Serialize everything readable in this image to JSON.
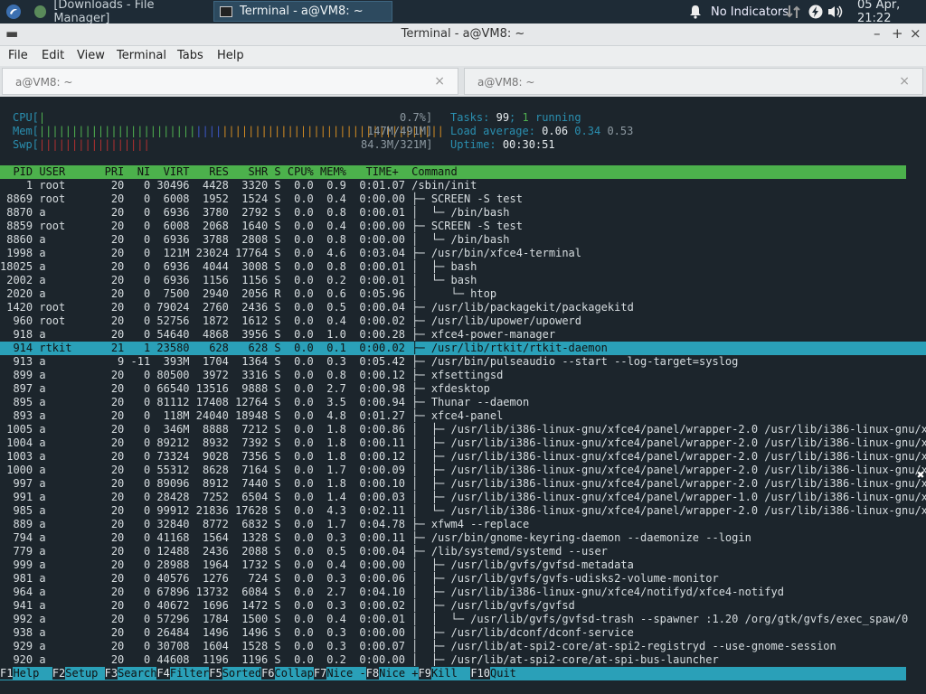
{
  "panel": {
    "task1": "[Downloads - File Manager]",
    "task2": "Terminal - a@VM8: ~",
    "indicators": "No Indicators",
    "clock": "05 Apr, 21:22"
  },
  "window": {
    "title": "Terminal - a@VM8: ~",
    "menu": [
      "File",
      "Edit",
      "View",
      "Terminal",
      "Tabs",
      "Help"
    ],
    "tabs": [
      {
        "label": "a@VM8: ~",
        "close": "×"
      },
      {
        "label": "a@VM8: ~",
        "close": "×"
      }
    ]
  },
  "htop": {
    "cpu": {
      "label": "CPU[",
      "bar": "|",
      "value": "0.7%]"
    },
    "mem": {
      "label": "Mem[",
      "bar_used": "||||||||||||||||||||||||",
      "bar_buf": "||||",
      "bar_cache": "||||||||||||||||||||||||||||||||||",
      "value": "147M/491M]"
    },
    "swp": {
      "label": "Swp[",
      "bar": "|||||||||||||||||",
      "value": "84.3M/321M]"
    },
    "tasks": {
      "label": "Tasks:",
      "count": "99",
      "sep": ";",
      "running": "1",
      "running_label": "running"
    },
    "load": {
      "label": "Load average:",
      "one": "0.06",
      "five": "0.34",
      "fifteen": "0.53"
    },
    "uptime": {
      "label": "Uptime:",
      "value": "00:30:51"
    },
    "header": "  PID USER      PRI  NI  VIRT   RES   SHR S CPU% MEM%   TIME+  Command",
    "rows": [
      "    1 root       20   0 30496  4428  3320 S  0.0  0.9  0:01.07 /sbin/init",
      " 8869 root       20   0  6008  1952  1524 S  0.0  0.4  0:00.00 ├─ SCREEN -S test",
      " 8870 a          20   0  6936  3780  2792 S  0.0  0.8  0:00.01 │  └─ /bin/bash",
      " 8859 root       20   0  6008  2068  1640 S  0.0  0.4  0:00.00 ├─ SCREEN -S test",
      " 8860 a          20   0  6936  3788  2808 S  0.0  0.8  0:00.00 │  └─ /bin/bash",
      " 1998 a          20   0  121M 23024 17764 S  0.0  4.6  0:03.04 ├─ /usr/bin/xfce4-terminal",
      "18025 a          20   0  6936  4044  3008 S  0.0  0.8  0:00.01 │  ├─ bash",
      " 2002 a          20   0  6936  1156  1156 S  0.0  0.2  0:00.01 │  └─ bash",
      " 2020 a          20   0  7500  2940  2056 R  0.0  0.6  0:05.96 │     └─ htop",
      " 1420 root       20   0 79024  2760  2436 S  0.0  0.5  0:00.04 ├─ /usr/lib/packagekit/packagekitd",
      "  960 root       20   0 52756  1872  1612 S  0.0  0.4  0:00.02 ├─ /usr/lib/upower/upowerd",
      "  918 a          20   0 54640  4868  3956 S  0.0  1.0  0:00.28 ├─ xfce4-power-manager",
      "  914 rtkit      21   1 23580   628   628 S  0.0  0.1  0:00.02 ├─ /usr/lib/rtkit/rtkit-daemon",
      "  913 a           9 -11  393M  1704  1364 S  0.0  0.3  0:05.42 ├─ /usr/bin/pulseaudio --start --log-target=syslog",
      "  899 a          20   0 80500  3972  3316 S  0.0  0.8  0:00.12 ├─ xfsettingsd",
      "  897 a          20   0 66540 13516  9888 S  0.0  2.7  0:00.98 ├─ xfdesktop",
      "  895 a          20   0 81112 17408 12764 S  0.0  3.5  0:00.94 ├─ Thunar --daemon",
      "  893 a          20   0  118M 24040 18948 S  0.0  4.8  0:01.27 ├─ xfce4-panel",
      " 1005 a          20   0  346M  8888  7212 S  0.0  1.8  0:00.86 │  ├─ /usr/lib/i386-linux-gnu/xfce4/panel/wrapper-2.0 /usr/lib/i386-linux-gnu/xf",
      " 1004 a          20   0 89212  8932  7392 S  0.0  1.8  0:00.11 │  ├─ /usr/lib/i386-linux-gnu/xfce4/panel/wrapper-2.0 /usr/lib/i386-linux-gnu/xf",
      " 1003 a          20   0 73324  9028  7356 S  0.0  1.8  0:00.12 │  ├─ /usr/lib/i386-linux-gnu/xfce4/panel/wrapper-2.0 /usr/lib/i386-linux-gnu/xf",
      " 1000 a          20   0 55312  8628  7164 S  0.0  1.7  0:00.09 │  ├─ /usr/lib/i386-linux-gnu/xfce4/panel/wrapper-2.0 /usr/lib/i386-linux-gnu/xf",
      "  997 a          20   0 89096  8912  7440 S  0.0  1.8  0:00.10 │  ├─ /usr/lib/i386-linux-gnu/xfce4/panel/wrapper-2.0 /usr/lib/i386-linux-gnu/xf",
      "  991 a          20   0 28428  7252  6504 S  0.0  1.4  0:00.03 │  ├─ /usr/lib/i386-linux-gnu/xfce4/panel/wrapper-1.0 /usr/lib/i386-linux-gnu/xf",
      "  985 a          20   0 99912 21836 17628 S  0.0  4.3  0:02.11 │  └─ /usr/lib/i386-linux-gnu/xfce4/panel/wrapper-2.0 /usr/lib/i386-linux-gnu/xf",
      "  889 a          20   0 32840  8772  6832 S  0.0  1.7  0:04.78 ├─ xfwm4 --replace",
      "  794 a          20   0 41168  1564  1328 S  0.0  0.3  0:00.11 ├─ /usr/bin/gnome-keyring-daemon --daemonize --login",
      "  779 a          20   0 12488  2436  2088 S  0.0  0.5  0:00.04 ├─ /lib/systemd/systemd --user",
      "  999 a          20   0 28988  1964  1732 S  0.0  0.4  0:00.00 │  ├─ /usr/lib/gvfs/gvfsd-metadata",
      "  981 a          20   0 40576  1276   724 S  0.0  0.3  0:00.06 │  ├─ /usr/lib/gvfs/gvfs-udisks2-volume-monitor",
      "  964 a          20   0 67896 13732  6084 S  0.0  2.7  0:04.10 │  ├─ /usr/lib/i386-linux-gnu/xfce4/notifyd/xfce4-notifyd",
      "  941 a          20   0 40672  1696  1472 S  0.0  0.3  0:00.02 │  ├─ /usr/lib/gvfs/gvfsd",
      "  992 a          20   0 57296  1784  1500 S  0.0  0.4  0:00.01 │  │  └─ /usr/lib/gvfs/gvfsd-trash --spawner :1.20 /org/gtk/gvfs/exec_spaw/0",
      "  938 a          20   0 26484  1496  1496 S  0.0  0.3  0:00.00 │  ├─ /usr/lib/dconf/dconf-service",
      "  929 a          20   0 30708  1604  1528 S  0.0  0.3  0:00.07 │  ├─ /usr/lib/at-spi2-core/at-spi2-registryd --use-gnome-session",
      "  920 a          20   0 44608  1196  1196 S  0.0  0.2  0:00.00 │  ├─ /usr/lib/at-spi2-core/at-spi-bus-launcher"
    ],
    "selected_row": 12,
    "fkeys": [
      {
        "key": "F1",
        "label": "Help  "
      },
      {
        "key": "F2",
        "label": "Setup "
      },
      {
        "key": "F3",
        "label": "Search"
      },
      {
        "key": "F4",
        "label": "Filter"
      },
      {
        "key": "F5",
        "label": "Sorted"
      },
      {
        "key": "F6",
        "label": "Collap"
      },
      {
        "key": "F7",
        "label": "Nice -"
      },
      {
        "key": "F8",
        "label": "Nice +"
      },
      {
        "key": "F9",
        "label": "Kill  "
      },
      {
        "key": "F10",
        "label": "Quit"
      }
    ]
  },
  "colors": {
    "header_green": "#4cb14c",
    "select_cyan": "#2aa0b8",
    "term_bg": "#1c252c"
  }
}
